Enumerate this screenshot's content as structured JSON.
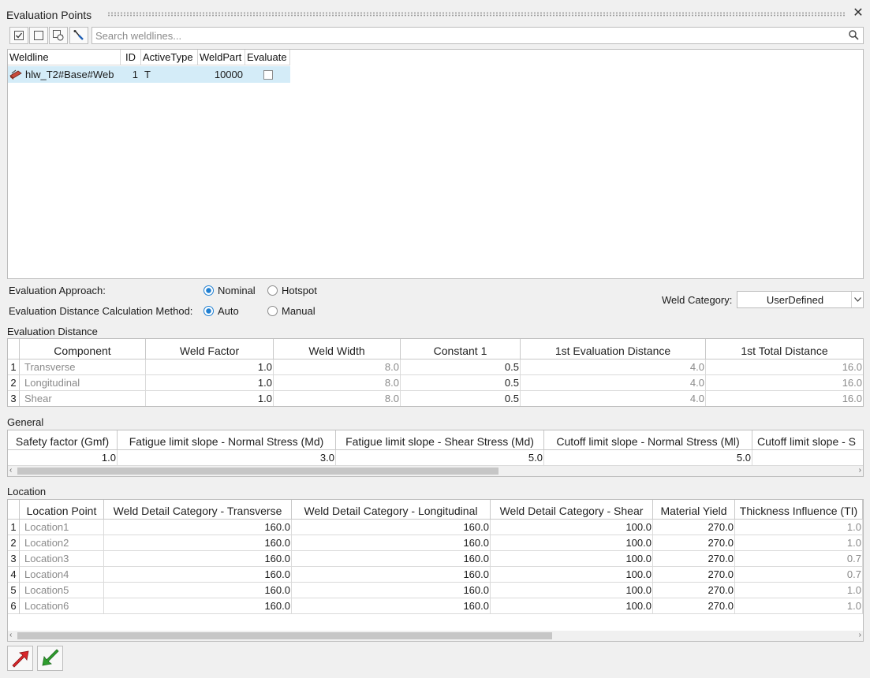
{
  "window": {
    "title": "Evaluation Points",
    "close_glyph": "✕"
  },
  "toolbar": {
    "icons": [
      "check-all-icon",
      "uncheck-icon",
      "refresh-icon",
      "pick-icon"
    ],
    "search_placeholder": "Search weldlines..."
  },
  "weldlines": {
    "columns": [
      "Weldline",
      "ID",
      "ActiveType",
      "WeldPart",
      "Evaluate"
    ],
    "rows": [
      {
        "weldline": "hlw_T2#Base#Web",
        "id": "1",
        "active_type": "T",
        "weld_part": "10000",
        "evaluate": false
      }
    ]
  },
  "options": {
    "approach_label": "Evaluation Approach:",
    "approach_nominal": "Nominal",
    "approach_hotspot": "Hotspot",
    "approach_selected": "Nominal",
    "distance_label": "Evaluation Distance Calculation Method:",
    "distance_auto": "Auto",
    "distance_manual": "Manual",
    "distance_selected": "Auto",
    "category_label": "Weld Category:",
    "category_value": "UserDefined"
  },
  "eval_distance": {
    "title": "Evaluation Distance",
    "columns": [
      "Component",
      "Weld Factor",
      "Weld Width",
      "Constant 1",
      "1st Evaluation Distance",
      "1st Total Distance"
    ],
    "rows": [
      [
        "1",
        "Transverse",
        "1.0",
        "8.0",
        "0.5",
        "4.0",
        "16.0"
      ],
      [
        "2",
        "Longitudinal",
        "1.0",
        "8.0",
        "0.5",
        "4.0",
        "16.0"
      ],
      [
        "3",
        "Shear",
        "1.0",
        "8.0",
        "0.5",
        "4.0",
        "16.0"
      ]
    ]
  },
  "general": {
    "title": "General",
    "columns": [
      "Safety factor (Gmf)",
      "Fatigue limit slope - Normal Stress (Md)",
      "Fatigue limit slope - Shear Stress (Md)",
      "Cutoff limit slope - Normal Stress (Ml)",
      "Cutoff limit slope - S"
    ],
    "values": [
      "1.0",
      "3.0",
      "5.0",
      "5.0",
      ""
    ]
  },
  "location": {
    "title": "Location",
    "columns": [
      "Location Point",
      "Weld Detail Category - Transverse",
      "Weld Detail Category - Longitudinal",
      "Weld Detail Category - Shear",
      "Material Yield",
      "Thickness Influence (TI)"
    ],
    "rows": [
      [
        "1",
        "Location1",
        "160.0",
        "160.0",
        "100.0",
        "270.0",
        "1.0"
      ],
      [
        "2",
        "Location2",
        "160.0",
        "160.0",
        "100.0",
        "270.0",
        "1.0"
      ],
      [
        "3",
        "Location3",
        "160.0",
        "160.0",
        "100.0",
        "270.0",
        "0.7"
      ],
      [
        "4",
        "Location4",
        "160.0",
        "160.0",
        "100.0",
        "270.0",
        "0.7"
      ],
      [
        "5",
        "Location5",
        "160.0",
        "160.0",
        "100.0",
        "270.0",
        "1.0"
      ],
      [
        "6",
        "Location6",
        "160.0",
        "160.0",
        "100.0",
        "270.0",
        "1.0"
      ]
    ]
  },
  "scroll_arrows": {
    "left": "‹",
    "right": "›"
  },
  "footer": {
    "icons": [
      "export-red-arrow-icon",
      "import-green-arrow-icon"
    ]
  },
  "colors": {
    "accent": "#1f7fd1",
    "selected_row": "#d4ecf8",
    "red_arrow": "#d9252a",
    "green_arrow": "#2f9e2f"
  }
}
